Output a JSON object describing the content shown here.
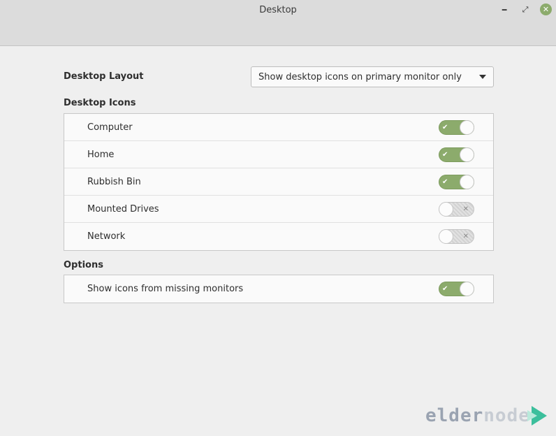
{
  "window": {
    "title": "Desktop",
    "controls": {
      "minimize_icon": "minimize-icon",
      "maximize_icon": "maximize-icon",
      "close_icon": "close-icon"
    }
  },
  "layout": {
    "label": "Desktop Layout",
    "selected": "Show desktop icons on primary monitor only"
  },
  "icons_section": {
    "label": "Desktop Icons",
    "items": [
      {
        "label": "Computer",
        "enabled": true
      },
      {
        "label": "Home",
        "enabled": true
      },
      {
        "label": "Rubbish Bin",
        "enabled": true
      },
      {
        "label": "Mounted Drives",
        "enabled": false
      },
      {
        "label": "Network",
        "enabled": false
      }
    ]
  },
  "options_section": {
    "label": "Options",
    "items": [
      {
        "label": "Show icons from missing monitors",
        "enabled": true
      }
    ]
  },
  "watermark": {
    "text_left": "elder",
    "text_right": "node"
  },
  "colors": {
    "accent": "#8cab6c",
    "titlebar": "#dcdcdc",
    "background": "#efefef",
    "panel": "#fafafa"
  }
}
